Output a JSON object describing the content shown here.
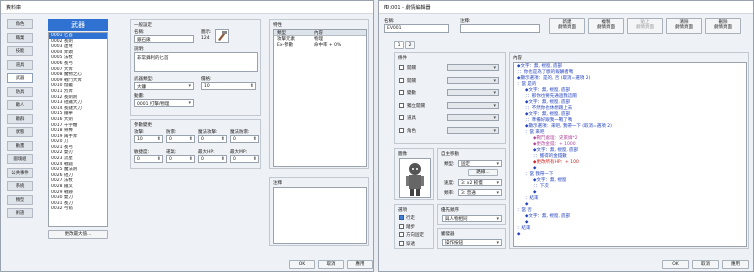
{
  "left": {
    "title": "資料庫",
    "tabs": [
      "角色",
      "職業",
      "技能",
      "道具",
      "武器",
      "防具",
      "敵人",
      "敵群",
      "狀態",
      "動畫",
      "圖塊組",
      "公共事件",
      "系統",
      "類型",
      "術語"
    ],
    "active_tab": 4,
    "list_header": "武器",
    "items": [
      "0001 匕首",
      "0002 長劍",
      "0003 連弩",
      "0004 斧頭",
      "0005 法杖",
      "0006 長弓",
      "0007 大斧",
      "0008 魔物之心",
      "0009 戰鬥大斧",
      "0010 燈籠",
      "0011 烈斧",
      "0012 長劍劍",
      "0013 短鐵大刀",
      "0014 長鏈大刀",
      "0015 鐵拳",
      "0016 大劍",
      "0017 十字槍",
      "0018 骨棒",
      "0019 兩手斧",
      "0020 刀",
      "0021 長弓",
      "0022 雙刃",
      "0023 流星",
      "0024 戰鎚",
      "0025 魔法劍",
      "0026 短刀",
      "0027 法杖",
      "0028 鐵叉",
      "0029 戰錘",
      "0030 雙刀",
      "0031 長刀",
      "0032 弓箭"
    ],
    "selected_item": 0,
    "change_max_button": "更改最大值...",
    "general": {
      "header": "一般設定",
      "name_label": "名稱:",
      "name_value": "銀石鍬",
      "icon_label": "圖示:",
      "icon_index": "124",
      "desc_label": "說明:",
      "desc_value": "非常鋒利的匕首",
      "type_label": "武器類型:",
      "type_value": "大鐮",
      "price_label": "價格:",
      "price_value": "10",
      "anim_label": "動畫:",
      "anim_value": "0001 打擊/物理"
    },
    "params": {
      "header": "參數變更",
      "labels": [
        "攻擊:",
        "防禦:",
        "魔法攻擊:",
        "魔法防禦:",
        "敏捷度:",
        "運氣:",
        "最大HP:",
        "最大MP:"
      ],
      "values": [
        "10",
        "0",
        "0",
        "0",
        "0",
        "0",
        "0",
        "0"
      ]
    },
    "traits": {
      "header": "特性",
      "col1": "類型",
      "col2": "內容",
      "rows": [
        [
          "攻擊元素",
          "物理"
        ],
        [
          "Ex-參數",
          "命中率 + 0%"
        ]
      ]
    },
    "note_header": "注釋",
    "ok": "OK",
    "cancel": "取消",
    "apply": "應用"
  },
  "right": {
    "title": "ID:001 - 劇情編輯器",
    "name_label": "名稱:",
    "name_value": "EV001",
    "note_label": "注釋:",
    "top_buttons": [
      "新建\n劇情頁面",
      "複製\n劇情頁面",
      "貼上\n劇情頁面",
      "清除\n劇情頁面",
      "刪除\n劇情頁面"
    ],
    "page_tabs": [
      "1",
      "2"
    ],
    "conditions_header": "條件",
    "conditions": [
      "開關",
      "開關",
      "變數",
      "獨立開關",
      "道具",
      "角色"
    ],
    "image_header": "圖像",
    "auto_move": {
      "header": "自主移動",
      "type_label": "類型:",
      "type_value": "固定",
      "route_button": "路線...",
      "speed_label": "速度:",
      "speed_value": "3: x2 較慢",
      "freq_label": "頻率:",
      "freq_value": "3: 普通"
    },
    "options": {
      "header": "選項",
      "items": [
        "行走",
        "踏步",
        "方向固定",
        "穿透"
      ],
      "checked": [
        true,
        false,
        false,
        false
      ]
    },
    "priority": {
      "header": "優先順序",
      "value": "與人物相同"
    },
    "trigger": {
      "header": "觸發器",
      "value": "操作按鈕"
    },
    "contents_header": "內容",
    "commands": [
      {
        "text": "◆文字：無, 視窗, 底部",
        "color": "#1f3fbf",
        "indent": 0
      },
      {
        "text": "：：你也是為了斷的報酬者嗎",
        "color": "#1f3fbf",
        "indent": 0
      },
      {
        "text": "◆顯示選項：是的, 否 (取消=選項 2)",
        "color": "#1f3fbf",
        "indent": 0
      },
      {
        "text": "：當 是的",
        "color": "#1f3fbf",
        "indent": 0
      },
      {
        "text": "◆文字：無, 視窗, 底部",
        "color": "#1f3fbf",
        "indent": 1
      },
      {
        "text": "：：那你也要先通過我這關",
        "color": "#1f3fbf",
        "indent": 1
      },
      {
        "text": "◆文字：無, 視窗, 底部",
        "color": "#1f3fbf",
        "indent": 1
      },
      {
        "text": "：：不然你也休想踏上去",
        "color": "#1f3fbf",
        "indent": 1
      },
      {
        "text": "◆文字：無, 視窗, 底部",
        "color": "#1f3fbf",
        "indent": 1
      },
      {
        "text": "：：準備好跟我一戰了嗎",
        "color": "#1f3fbf",
        "indent": 1
      },
      {
        "text": "◆顯示選項：來吧, 我帶一下 (取消=選項 2)",
        "color": "#1f3fbf",
        "indent": 1
      },
      {
        "text": "：當 來吧",
        "color": "#1f3fbf",
        "indent": 1
      },
      {
        "text": "◆戰鬥處理：史萊姆*2",
        "color": "#b04a9c",
        "indent": 2
      },
      {
        "text": "◆更改金錢：+ 1000",
        "color": "#b04a9c",
        "indent": 2
      },
      {
        "text": "◆文字：無, 視窗, 底部",
        "color": "#1f3fbf",
        "indent": 2
      },
      {
        "text": "：：獲得的金錢數",
        "color": "#1f3fbf",
        "indent": 2
      },
      {
        "text": "◆更改所有HP：+ 100",
        "color": "#d02020",
        "indent": 2
      },
      {
        "text": "◆",
        "color": "#1f3fbf",
        "indent": 2
      },
      {
        "text": "：當 我帶一下",
        "color": "#1f3fbf",
        "indent": 1
      },
      {
        "text": "◆文字：無, 視窗",
        "color": "#1f3fbf",
        "indent": 2
      },
      {
        "text": "：：下次",
        "color": "#1f3fbf",
        "indent": 2
      },
      {
        "text": "◆",
        "color": "#1f3fbf",
        "indent": 2
      },
      {
        "text": "：結束",
        "color": "#1f3fbf",
        "indent": 1
      },
      {
        "text": "◆",
        "color": "#1f3fbf",
        "indent": 1
      },
      {
        "text": "：當 否",
        "color": "#1f3fbf",
        "indent": 0
      },
      {
        "text": "◆文字：無, 視窗, 底部",
        "color": "#1f3fbf",
        "indent": 1
      },
      {
        "text": "◆",
        "color": "#1f3fbf",
        "indent": 1
      },
      {
        "text": "：結束",
        "color": "#1f3fbf",
        "indent": 0
      },
      {
        "text": "◆",
        "color": "#1f3fbf",
        "indent": 0
      }
    ],
    "ok": "OK",
    "cancel": "取消",
    "apply": "應用"
  },
  "colors": {
    "accent": "#2f72d1",
    "border": "#9aa3ad",
    "bg": "#eef1f5"
  }
}
